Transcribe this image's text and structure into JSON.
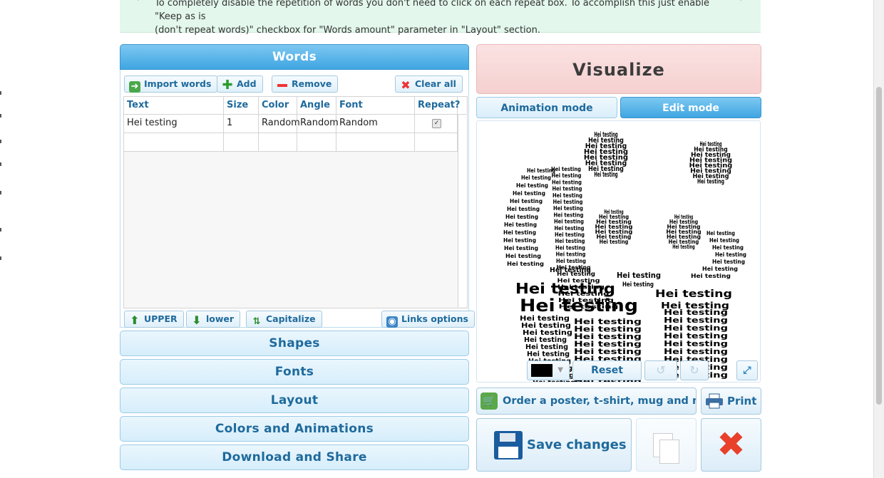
{
  "tip": {
    "line1": "To completely disable the repetition of words you don't need to click on each repeat box. To accomplish this just enable \"Keep as is",
    "line2": "(don't repeat words)\" checkbox for \"Words amount\" parameter in \"Layout\" section."
  },
  "words_panel": {
    "title": "Words",
    "toolbar": {
      "import_label": "Import words",
      "add_label": "Add",
      "remove_label": "Remove",
      "clear_label": "Clear all"
    },
    "columns": [
      "Text",
      "Size",
      "Color",
      "Angle",
      "Font",
      "Repeat?"
    ],
    "rows": [
      {
        "text": "Hei testing",
        "size": "1",
        "color": "Random",
        "angle": "Random",
        "font": "Random",
        "repeat": true
      }
    ],
    "bottom_toolbar": {
      "upper_label": "UPPER",
      "lower_label": "lower",
      "capitalize_label": "Capitalize",
      "links_label": "Links options"
    }
  },
  "sections": {
    "shapes": "Shapes",
    "fonts": "Fonts",
    "layout": "Layout",
    "colors": "Colors and Animations",
    "download": "Download and Share"
  },
  "visualize": {
    "label": "Visualize"
  },
  "modes": {
    "animation": "Animation mode",
    "edit": "Edit mode",
    "active": "edit"
  },
  "canvas": {
    "word": "Hei testing",
    "background_color": "#000000",
    "reset_label": "Reset"
  },
  "actions": {
    "order_label": "Order a poster, t-shirt, mug and more",
    "print_label": "Print",
    "save_label": "Save changes"
  },
  "colors": {
    "accent": "#3fa6e2",
    "header_text": "#1f6a9c",
    "visualize_bg": "#f5d0d0",
    "tip_bg": "#e3f7ec",
    "close_red": "#e8402a"
  }
}
